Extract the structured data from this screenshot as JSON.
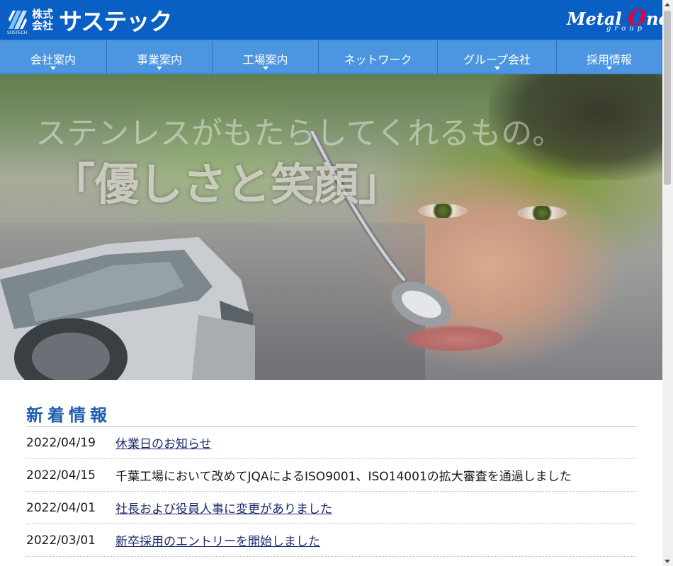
{
  "header": {
    "logo_kk": "株式会社",
    "logo_name": "サステック",
    "logo_sub": "SUSTECH",
    "group_name_before": "Metal ",
    "group_name_o": "O",
    "group_name_after": "ne",
    "group_sub": "group"
  },
  "nav": {
    "items": [
      {
        "label": "会社案内",
        "has_dropdown": true
      },
      {
        "label": "事業案内",
        "has_dropdown": true
      },
      {
        "label": "工場案内",
        "has_dropdown": true
      },
      {
        "label": "ネットワーク",
        "has_dropdown": false
      },
      {
        "label": "グループ会社",
        "has_dropdown": true
      },
      {
        "label": "採用情報",
        "has_dropdown": true
      }
    ]
  },
  "hero": {
    "line1": "ステンレスがもたらしてくれるもの。",
    "line2": "「優しさと笑顔」"
  },
  "news": {
    "title": "新着情報",
    "items": [
      {
        "date": "2022/04/19",
        "text": "休業日のお知らせ",
        "link": true
      },
      {
        "date": "2022/04/15",
        "text": "千葉工場において改めてJQAによるISO9001、ISO14001の拡大審査を通過しました",
        "link": false
      },
      {
        "date": "2022/04/01",
        "text": "社長および役員人事に変更がありました",
        "link": true
      },
      {
        "date": "2022/03/01",
        "text": "新卒採用のエントリーを開始しました",
        "link": true
      }
    ]
  },
  "colors": {
    "header_bg": "#0a5fc4",
    "nav_bg": "#4c95e0",
    "news_title": "#1f5fb0",
    "link": "#1c2a6e",
    "brand_accent": "#e8003a"
  }
}
